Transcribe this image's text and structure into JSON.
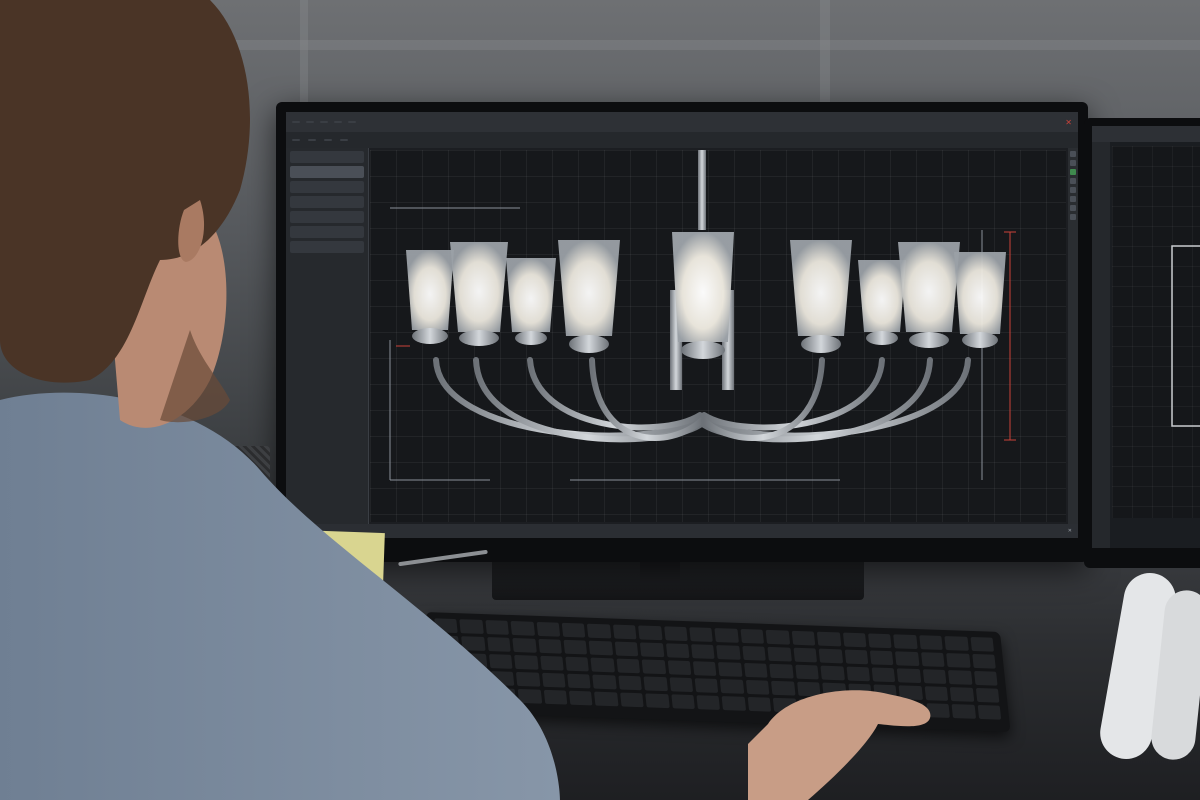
{
  "scene": {
    "description_labels": []
  },
  "app": {
    "menu": [
      "",
      "",
      "",
      "",
      "",
      "",
      "",
      "",
      ""
    ],
    "sidebar_items": [
      {
        "label": ""
      },
      {
        "label": ""
      },
      {
        "label": ""
      },
      {
        "label": ""
      },
      {
        "label": ""
      },
      {
        "label": ""
      },
      {
        "label": ""
      }
    ],
    "sidebar_sub": [
      "",
      "",
      "",
      "",
      "",
      "",
      "",
      ""
    ]
  },
  "colors": {
    "screen_bg": "#16181b",
    "accent_red": "#c9423a",
    "glass_glow": "#f4f1ea",
    "chrome": "#b9bec4"
  },
  "icons": [
    "pencil-icon",
    "window-close-icon",
    "layer-icon"
  ]
}
